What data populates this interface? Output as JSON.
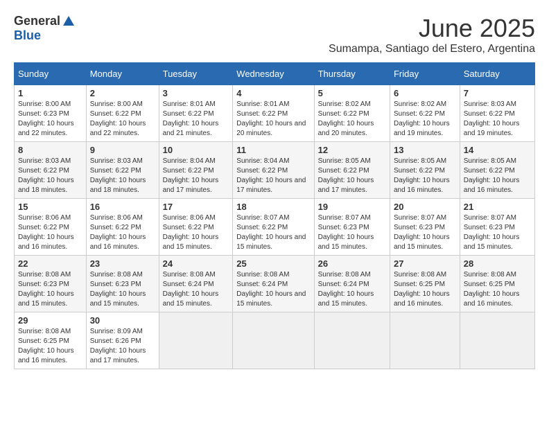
{
  "header": {
    "logo_general": "General",
    "logo_blue": "Blue",
    "title": "June 2025",
    "subtitle": "Sumampa, Santiago del Estero, Argentina"
  },
  "calendar": {
    "days_of_week": [
      "Sunday",
      "Monday",
      "Tuesday",
      "Wednesday",
      "Thursday",
      "Friday",
      "Saturday"
    ],
    "weeks": [
      [
        {
          "day": "",
          "empty": true
        },
        {
          "day": "",
          "empty": true
        },
        {
          "day": "",
          "empty": true
        },
        {
          "day": "",
          "empty": true
        },
        {
          "day": "",
          "empty": true
        },
        {
          "day": "",
          "empty": true
        },
        {
          "day": "",
          "empty": true
        }
      ]
    ],
    "cells": [
      {
        "day": "1",
        "sunrise": "8:00 AM",
        "sunset": "6:23 PM",
        "daylight": "10 hours and 22 minutes."
      },
      {
        "day": "2",
        "sunrise": "8:00 AM",
        "sunset": "6:22 PM",
        "daylight": "10 hours and 22 minutes."
      },
      {
        "day": "3",
        "sunrise": "8:01 AM",
        "sunset": "6:22 PM",
        "daylight": "10 hours and 21 minutes."
      },
      {
        "day": "4",
        "sunrise": "8:01 AM",
        "sunset": "6:22 PM",
        "daylight": "10 hours and 20 minutes."
      },
      {
        "day": "5",
        "sunrise": "8:02 AM",
        "sunset": "6:22 PM",
        "daylight": "10 hours and 20 minutes."
      },
      {
        "day": "6",
        "sunrise": "8:02 AM",
        "sunset": "6:22 PM",
        "daylight": "10 hours and 19 minutes."
      },
      {
        "day": "7",
        "sunrise": "8:03 AM",
        "sunset": "6:22 PM",
        "daylight": "10 hours and 19 minutes."
      },
      {
        "day": "8",
        "sunrise": "8:03 AM",
        "sunset": "6:22 PM",
        "daylight": "10 hours and 18 minutes."
      },
      {
        "day": "9",
        "sunrise": "8:03 AM",
        "sunset": "6:22 PM",
        "daylight": "10 hours and 18 minutes."
      },
      {
        "day": "10",
        "sunrise": "8:04 AM",
        "sunset": "6:22 PM",
        "daylight": "10 hours and 17 minutes."
      },
      {
        "day": "11",
        "sunrise": "8:04 AM",
        "sunset": "6:22 PM",
        "daylight": "10 hours and 17 minutes."
      },
      {
        "day": "12",
        "sunrise": "8:05 AM",
        "sunset": "6:22 PM",
        "daylight": "10 hours and 17 minutes."
      },
      {
        "day": "13",
        "sunrise": "8:05 AM",
        "sunset": "6:22 PM",
        "daylight": "10 hours and 16 minutes."
      },
      {
        "day": "14",
        "sunrise": "8:05 AM",
        "sunset": "6:22 PM",
        "daylight": "10 hours and 16 minutes."
      },
      {
        "day": "15",
        "sunrise": "8:06 AM",
        "sunset": "6:22 PM",
        "daylight": "10 hours and 16 minutes."
      },
      {
        "day": "16",
        "sunrise": "8:06 AM",
        "sunset": "6:22 PM",
        "daylight": "10 hours and 16 minutes."
      },
      {
        "day": "17",
        "sunrise": "8:06 AM",
        "sunset": "6:22 PM",
        "daylight": "10 hours and 15 minutes."
      },
      {
        "day": "18",
        "sunrise": "8:07 AM",
        "sunset": "6:22 PM",
        "daylight": "10 hours and 15 minutes."
      },
      {
        "day": "19",
        "sunrise": "8:07 AM",
        "sunset": "6:23 PM",
        "daylight": "10 hours and 15 minutes."
      },
      {
        "day": "20",
        "sunrise": "8:07 AM",
        "sunset": "6:23 PM",
        "daylight": "10 hours and 15 minutes."
      },
      {
        "day": "21",
        "sunrise": "8:07 AM",
        "sunset": "6:23 PM",
        "daylight": "10 hours and 15 minutes."
      },
      {
        "day": "22",
        "sunrise": "8:08 AM",
        "sunset": "6:23 PM",
        "daylight": "10 hours and 15 minutes."
      },
      {
        "day": "23",
        "sunrise": "8:08 AM",
        "sunset": "6:23 PM",
        "daylight": "10 hours and 15 minutes."
      },
      {
        "day": "24",
        "sunrise": "8:08 AM",
        "sunset": "6:24 PM",
        "daylight": "10 hours and 15 minutes."
      },
      {
        "day": "25",
        "sunrise": "8:08 AM",
        "sunset": "6:24 PM",
        "daylight": "10 hours and 15 minutes."
      },
      {
        "day": "26",
        "sunrise": "8:08 AM",
        "sunset": "6:24 PM",
        "daylight": "10 hours and 15 minutes."
      },
      {
        "day": "27",
        "sunrise": "8:08 AM",
        "sunset": "6:25 PM",
        "daylight": "10 hours and 16 minutes."
      },
      {
        "day": "28",
        "sunrise": "8:08 AM",
        "sunset": "6:25 PM",
        "daylight": "10 hours and 16 minutes."
      },
      {
        "day": "29",
        "sunrise": "8:08 AM",
        "sunset": "6:25 PM",
        "daylight": "10 hours and 16 minutes."
      },
      {
        "day": "30",
        "sunrise": "8:09 AM",
        "sunset": "6:26 PM",
        "daylight": "10 hours and 17 minutes."
      }
    ]
  }
}
